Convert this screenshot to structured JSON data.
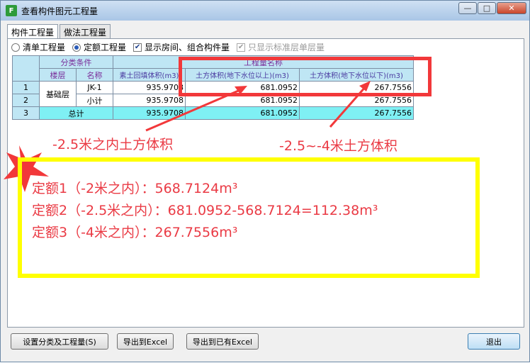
{
  "window": {
    "title": "查看构件图元工程量"
  },
  "tabs": [
    {
      "label": "构件工程量"
    },
    {
      "label": "做法工程量"
    }
  ],
  "options": {
    "radio1": "清单工程量",
    "radio2": "定额工程量",
    "check1": "显示房间、组合构件量",
    "check2": "只显示标准层单层量"
  },
  "table": {
    "group_header": "分类条件",
    "quantity_header": "工程量名称",
    "col_floor": "楼层",
    "col_name": "名称",
    "col_q1": "素土回填体积(m3)",
    "col_q2": "土方体积(地下水位以上)(m3)",
    "col_q3": "土方体积(地下水位以下)(m3)",
    "rows": [
      {
        "num": "1",
        "floor": "基础层",
        "name": "JK-1",
        "q1": "935.9708",
        "q2": "681.0952",
        "q3": "267.7556"
      },
      {
        "num": "2",
        "name": "小计",
        "q1": "935.9708",
        "q2": "681.0952",
        "q3": "267.7556"
      },
      {
        "num": "3",
        "name": "总计",
        "q1": "935.9708",
        "q2": "681.0952",
        "q3": "267.7556"
      }
    ]
  },
  "annotations": {
    "left_label": "-2.5米之内土方体积",
    "right_label": "-2.5~-4米土方体积",
    "line1": "定额1（-2米之内）：568.7124m³",
    "line2": "定额2（-2.5米之内）：681.0952-568.7124=112.38m³",
    "line3": "定额3（-4米之内）：267.7556m³"
  },
  "buttons": {
    "settings": "设置分类及工程量(S)",
    "export": "导出到Excel",
    "export_existing": "导出到已有Excel",
    "exit": "退出"
  },
  "colors": {
    "annotation_red": "#f2383a",
    "highlight_yellow": "#ffff00",
    "total_cyan": "#7ff0f4"
  }
}
